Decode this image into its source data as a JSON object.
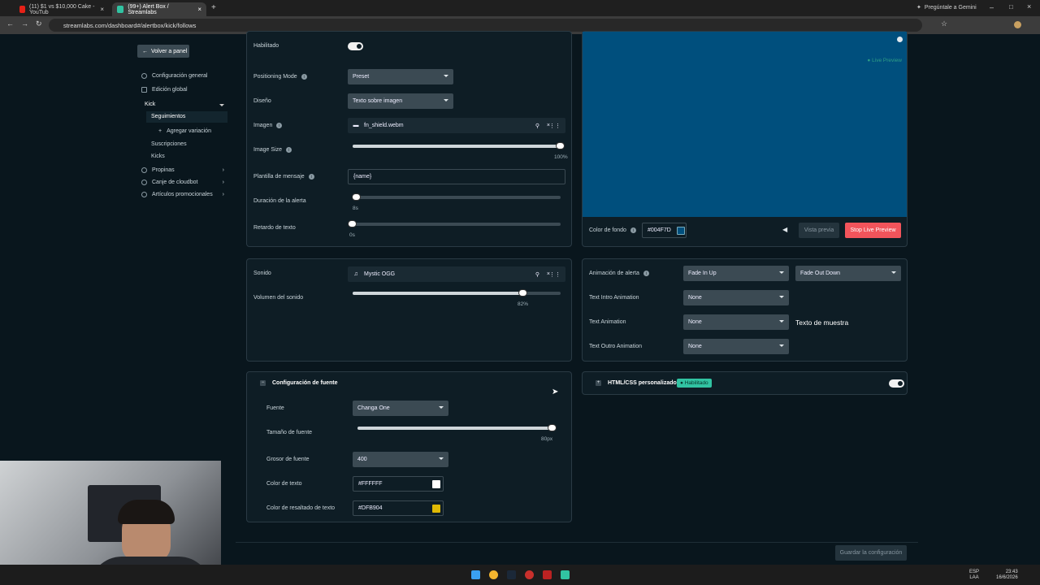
{
  "browser": {
    "tabs": [
      {
        "label": "(11) $1 vs $10,000 Cake - YouTub"
      },
      {
        "label": "(99+) Alert Box / Streamlabs"
      }
    ],
    "url": "streamlabs.com/dashboard#/alertbox/kick/follows",
    "gemini": "Pregúntale a Gemini"
  },
  "sidebar": {
    "back": "Volver a panel",
    "items": [
      {
        "label": "Configuración general",
        "icon": "gear-icon"
      },
      {
        "label": "Edición global",
        "icon": "grid-icon"
      },
      {
        "label": "Kick"
      },
      {
        "label": "Seguimientos"
      },
      {
        "label": "Agregar variación"
      },
      {
        "label": "Suscripciones"
      },
      {
        "label": "Kicks"
      },
      {
        "label": "Propinas"
      },
      {
        "label": "Canje de cloudbot"
      },
      {
        "label": "Artículos promocionales"
      }
    ]
  },
  "main": {
    "enabled_label": "Habilitado",
    "positioning_mode": {
      "label": "Positioning Mode",
      "value": "Preset"
    },
    "design": {
      "label": "Diseño",
      "value": "Texto sobre imagen"
    },
    "image": {
      "label": "Imagen",
      "file": "fn_shield.webm"
    },
    "image_size": {
      "label": "Image Size",
      "value_text": "100%",
      "value": 1.0
    },
    "message_template": {
      "label": "Plantilla de mensaje",
      "value": "{name}"
    },
    "alert_duration": {
      "label": "Duración de la alerta",
      "value_text": "8s",
      "value": 0.02
    },
    "text_delay": {
      "label": "Retardo de texto",
      "value_text": "0s",
      "value": 0.0
    }
  },
  "sound": {
    "label": "Sonido",
    "file": "Mystic OGG",
    "volume": {
      "label": "Volumen del sonido",
      "value_text": "82%",
      "value": 0.82
    }
  },
  "font_settings": {
    "title": "Configuración de fuente",
    "font": {
      "label": "Fuente",
      "value": "Changa One"
    },
    "font_size": {
      "label": "Tamaño de fuente",
      "value_text": "80px",
      "value": 1.0
    },
    "font_weight": {
      "label": "Grosor de fuente",
      "value": "400"
    },
    "text_color": {
      "label": "Color de texto",
      "value": "#FFFFFF"
    },
    "highlight_color": {
      "label": "Color de resaltado de texto",
      "value": "#DFB904"
    }
  },
  "preview": {
    "live": "● Live Preview",
    "bg_label": "Color de fondo",
    "bg_value": "#004F7D",
    "preview_button": "Vista previa",
    "stop_button": "Stop Live Preview"
  },
  "animation": {
    "label": "Animación de alerta",
    "in": "Fade In Up",
    "out": "Fade Out Down",
    "text_intro": {
      "label": "Text Intro Animation",
      "value": "None"
    },
    "text_anim": {
      "label": "Text Animation",
      "value": "None"
    },
    "text_outro": {
      "label": "Text Outro Animation",
      "value": "None"
    },
    "sample": "Texto de muestra"
  },
  "custom_html": {
    "label": "HTML/CSS personalizado",
    "badge": "● Habilitado"
  },
  "save_button": "Guardar la configuración",
  "system": {
    "lang": "ESP",
    "lang2": "LAA",
    "time": "23:43",
    "date": "16/6/2026"
  },
  "colors": {
    "accent": "#31c3a2",
    "danger": "#f2545b",
    "preview_bg": "#004F7D"
  }
}
